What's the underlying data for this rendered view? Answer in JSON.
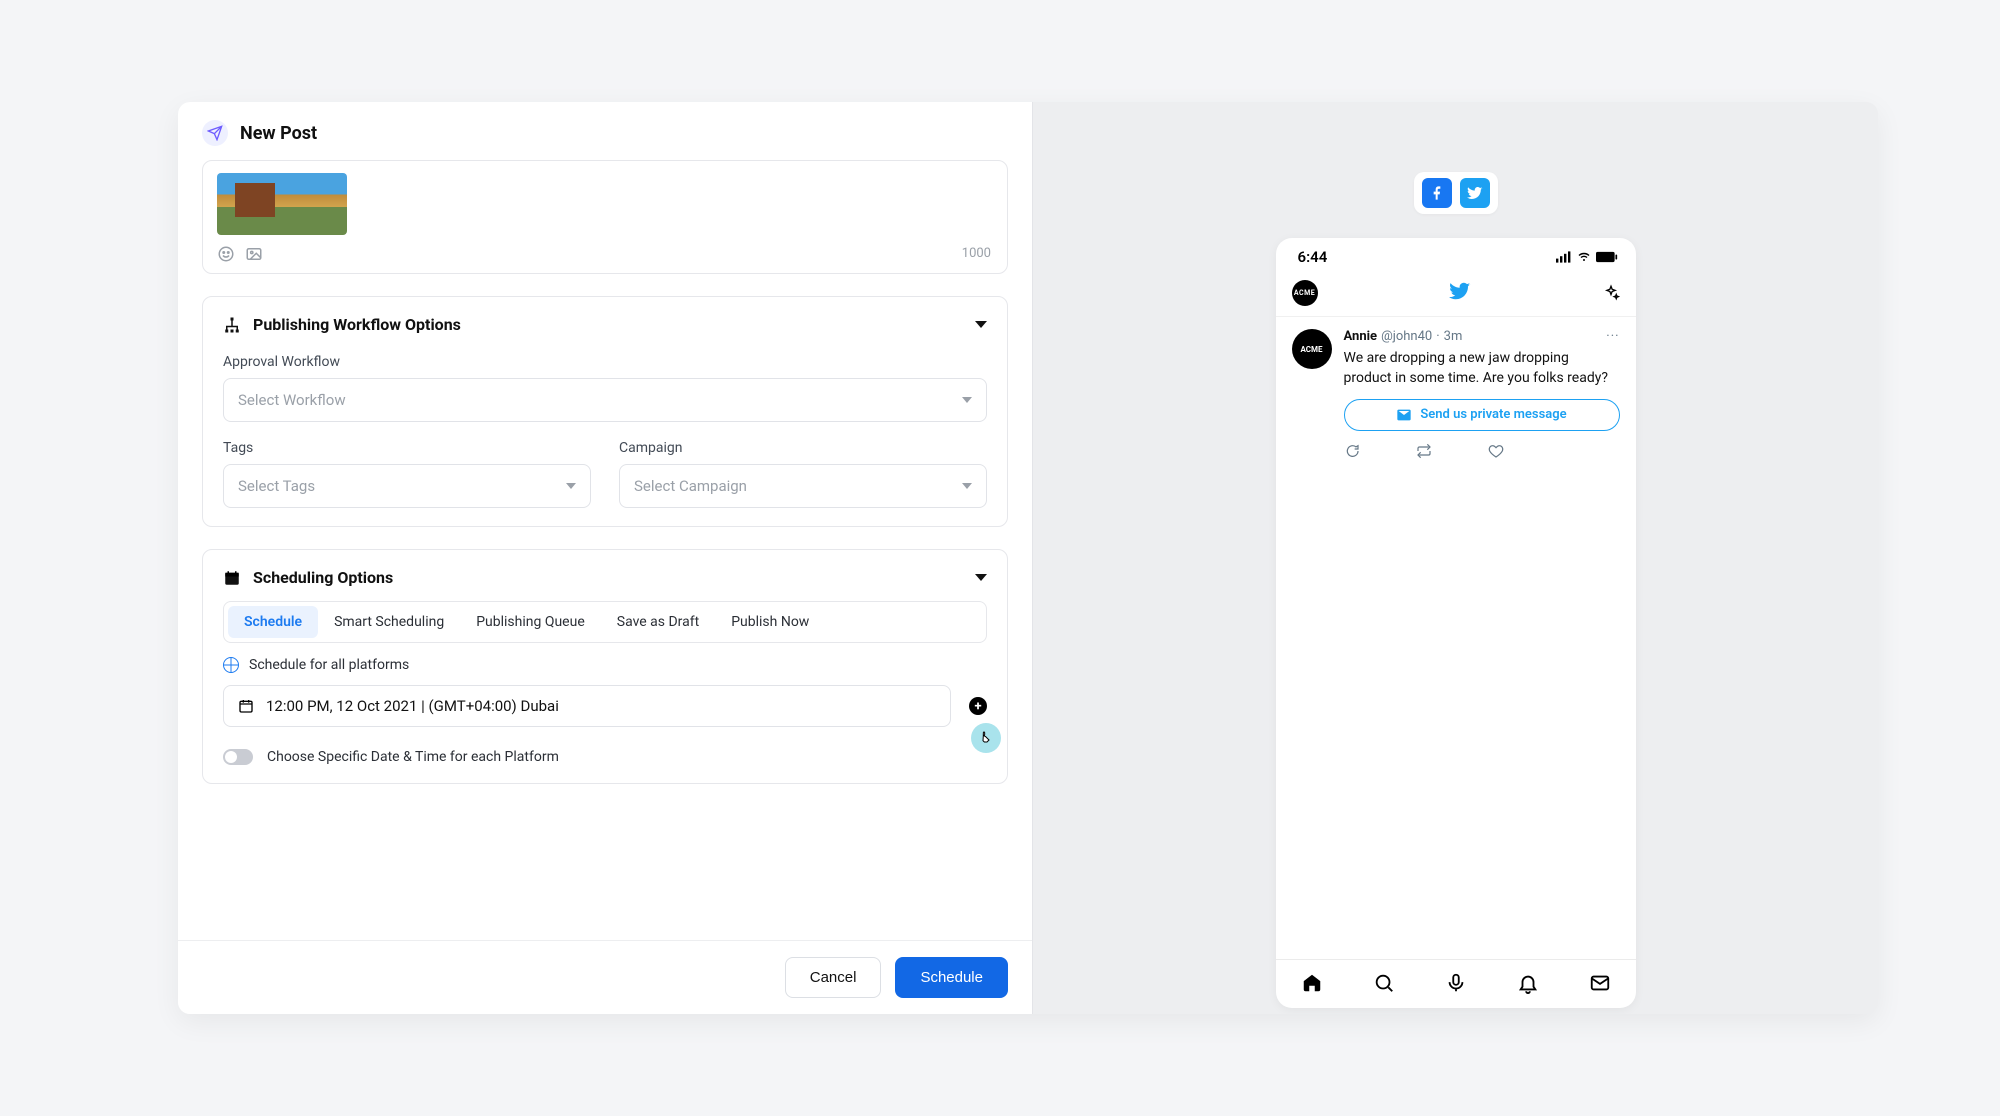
{
  "header": {
    "title": "New Post"
  },
  "media": {
    "char_count": "1000"
  },
  "workflow": {
    "title": "Publishing Workflow Options",
    "approval_label": "Approval Workflow",
    "approval_placeholder": "Select Workflow",
    "tags_label": "Tags",
    "tags_placeholder": "Select Tags",
    "campaign_label": "Campaign",
    "campaign_placeholder": "Select Campaign"
  },
  "scheduling": {
    "title": "Scheduling Options",
    "tabs": {
      "schedule": "Schedule",
      "smart": "Smart Scheduling",
      "queue": "Publishing Queue",
      "draft": "Save as Draft",
      "now": "Publish Now"
    },
    "schedule_all_label": "Schedule for all platforms",
    "datetime_value": "12:00 PM, 12 Oct 2021 | (GMT+04:00) Dubai",
    "specific_toggle_label": "Choose Specific Date & Time for each Platform"
  },
  "footer": {
    "cancel": "Cancel",
    "schedule": "Schedule"
  },
  "preview": {
    "status_time": "6:44",
    "acme_label": "ACME",
    "tweet": {
      "name": "Annie",
      "handle": "@john40",
      "time_sep": " · ",
      "time": "3m",
      "text": "We are dropping a new jaw dropping product in some time. Are you folks ready?",
      "dm_label": "Send us private message"
    }
  }
}
